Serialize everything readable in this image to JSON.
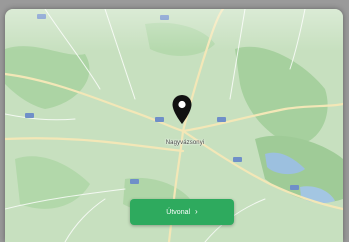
{
  "map": {
    "place_label": "Nagyvázsonyi",
    "colors": {
      "land": "#c9e2c1",
      "forest": "#a9d3a1",
      "road": "#f2e6b8",
      "water": "#9cc0df",
      "pin": "#111111"
    }
  },
  "action_button": {
    "label": "Útvonal",
    "arrow": "›",
    "color": "#2eaa5e"
  },
  "icons": {
    "pin": "map-pin-icon",
    "arrow": "chevron-right-icon"
  }
}
